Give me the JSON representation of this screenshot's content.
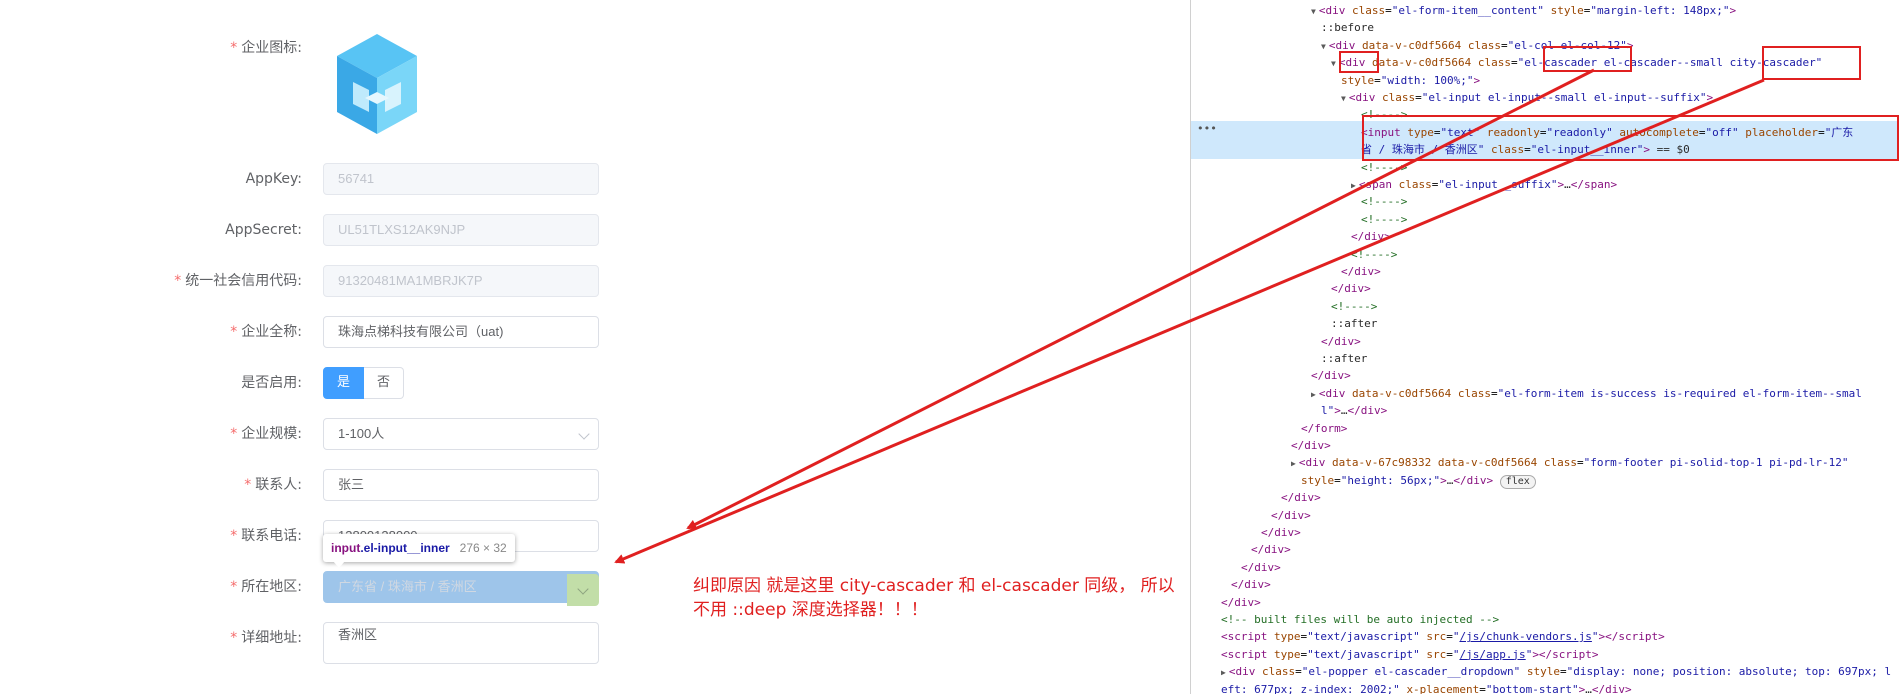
{
  "form": {
    "fields": [
      {
        "label": "企业图标:",
        "required": true
      },
      {
        "label": "AppKey:",
        "required": false,
        "value": "56741"
      },
      {
        "label": "AppSecret:",
        "required": false,
        "value": "UL51TLXS12AK9NJP"
      },
      {
        "label": "统一社会信用代码:",
        "required": true,
        "value": "91320481MA1MBRJK7P"
      },
      {
        "label": "企业全称:",
        "required": true,
        "value": "珠海点梯科技有限公司（uat)"
      },
      {
        "label": "是否启用:",
        "required": false,
        "options": [
          "是",
          "否"
        ],
        "selected": "是"
      },
      {
        "label": "企业规模:",
        "required": true,
        "value": "1-100人"
      },
      {
        "label": "联系人:",
        "required": true,
        "value": "张三"
      },
      {
        "label": "联系电话:",
        "required": true,
        "value": "13800138000"
      },
      {
        "label": "所在地区:",
        "required": true,
        "placeholder": "广东省 / 珠海市 / 香洲区"
      },
      {
        "label": "详细地址:",
        "required": true,
        "value": "香洲区"
      }
    ],
    "required_mark": "*",
    "tooltip": {
      "tag": "input",
      "cls": ".el-input__inner",
      "size": "276 × 32"
    }
  },
  "annotation": {
    "line1": "纠即原因 就是这里 city-cascader 和 el-cascader 同级， 所以",
    "line2": "不用 ::deep 深度选择器！！！"
  },
  "devtools": {
    "lines": [
      {
        "indent": 9,
        "tri": "▼",
        "html": "<span class='t'>&lt;div</span> <span class='a'>class</span>=<span class='v'>\"el-form-item__content\"</span> <span class='a'>style</span>=<span class='v'>\"margin-left: 148px;\"</span><span class='t'>&gt;</span>"
      },
      {
        "indent": 10,
        "html": "<span class='p'>::before</span>"
      },
      {
        "indent": 10,
        "tri": "▼",
        "html": "<span class='t'>&lt;div</span> <span class='a'>data-v-c0df5664</span> <span class='a'>class</span>=<span class='v'>\"el-col el-col-12\"</span><span class='t'>&gt;</span>"
      },
      {
        "indent": 11,
        "tri": "▼",
        "html": "<span class='t'>&lt;div</span> <span class='a'>data-v-c0df5664</span> <span class='a'>class</span>=<span class='v'>\"el-cascader el-cascader--small city-cascader\"</span>"
      },
      {
        "indent": 12,
        "html": "<span class='a'>style</span>=<span class='v'>\"width: 100%;\"</span><span class='t'>&gt;</span>"
      },
      {
        "indent": 12,
        "tri": "▼",
        "html": "<span class='t'>&lt;div</span> <span class='a'>class</span>=<span class='v'>\"el-input el-input--small el-input--suffix\"</span><span class='t'>&gt;</span>"
      },
      {
        "indent": 14,
        "html": "<span class='c'>&lt;!----&gt;</span>"
      },
      {
        "indent": 14,
        "html": "<span class='t'>&lt;input</span> <span class='a'>type</span>=<span class='v'>\"text\"</span> <span class='a'>readonly</span>=<span class='v'>\"readonly\"</span> <span class='a'>autocomplete</span>=<span class='v'>\"off\"</span> <span class='a'>placeholder</span>=<span class='v'>\"广东</span>"
      },
      {
        "indent": 14,
        "html": "<span class='v'>省 / 珠海市 / 香洲区\"</span> <span class='a'>class</span>=<span class='v'>\"el-input__inner\"</span><span class='t'>&gt;</span> <span class='p'>== $0</span>"
      },
      {
        "indent": 14,
        "html": "<span class='c'>&lt;!----&gt;</span>"
      },
      {
        "indent": 13,
        "tri": "▶",
        "html": "<span class='t'>&lt;span</span> <span class='a'>class</span>=<span class='v'>\"el-input__suffix\"</span><span class='t'>&gt;</span><span class='p'>…</span><span class='t'>&lt;/span&gt;</span>"
      },
      {
        "indent": 14,
        "html": "<span class='c'>&lt;!----&gt;</span>"
      },
      {
        "indent": 14,
        "html": "<span class='c'>&lt;!----&gt;</span>"
      },
      {
        "indent": 13,
        "html": "<span class='t'>&lt;/div&gt;</span>"
      },
      {
        "indent": 13,
        "html": "<span class='c'>&lt;!----&gt;</span>"
      },
      {
        "indent": 12,
        "html": "<span class='t'>&lt;/div&gt;</span>"
      },
      {
        "indent": 11,
        "html": "<span class='t'>&lt;/div&gt;</span>"
      },
      {
        "indent": 11,
        "html": "<span class='c'>&lt;!----&gt;</span>"
      },
      {
        "indent": 11,
        "html": "<span class='p'>::after</span>"
      },
      {
        "indent": 10,
        "html": "<span class='t'>&lt;/div&gt;</span>"
      },
      {
        "indent": 10,
        "html": "<span class='p'>::after</span>"
      },
      {
        "indent": 9,
        "html": "<span class='t'>&lt;/div&gt;</span>"
      },
      {
        "indent": 9,
        "tri": "▶",
        "html": "<span class='t'>&lt;div</span> <span class='a'>data-v-c0df5664</span> <span class='a'>class</span>=<span class='v'>\"el-form-item is-success is-required el-form-item--smal</span>"
      },
      {
        "indent": 10,
        "html": "<span class='v'>l\"</span><span class='t'>&gt;</span><span class='p'>…</span><span class='t'>&lt;/div&gt;</span>"
      },
      {
        "indent": 8,
        "html": "<span class='t'>&lt;/form&gt;</span>"
      },
      {
        "indent": 7,
        "html": "<span class='t'>&lt;/div&gt;</span>"
      },
      {
        "indent": 7,
        "tri": "▶",
        "html": "<span class='t'>&lt;div</span> <span class='a'>data-v-67c98332</span> <span class='a'>data-v-c0df5664</span> <span class='a'>class</span>=<span class='v'>\"form-footer pi-solid-top-1 pi-pd-lr-12\"</span>"
      },
      {
        "indent": 8,
        "html": "<span class='a'>style</span>=<span class='v'>\"height: 56px;\"</span><span class='t'>&gt;</span><span class='p'>…</span><span class='t'>&lt;/div&gt;</span> <span class='flexbadge'>flex</span>"
      },
      {
        "indent": 6,
        "html": "<span class='t'>&lt;/div&gt;</span>"
      },
      {
        "indent": 5,
        "html": "<span class='t'>&lt;/div&gt;</span>"
      },
      {
        "indent": 4,
        "html": "<span class='t'>&lt;/div&gt;</span>"
      },
      {
        "indent": 3,
        "html": "<span class='t'>&lt;/div&gt;</span>"
      },
      {
        "indent": 2,
        "html": "<span class='t'>&lt;/div&gt;</span>"
      },
      {
        "indent": 1,
        "html": "<span class='t'>&lt;/div&gt;</span>"
      },
      {
        "indent": 0,
        "html": "<span class='t'>&lt;/div&gt;</span>"
      },
      {
        "indent": 0,
        "html": "<span class='c'>&lt;!-- built files will be auto injected --&gt;</span>"
      },
      {
        "indent": 0,
        "html": "<span class='t'>&lt;script</span> <span class='a'>type</span>=<span class='v'>\"text/javascript\"</span> <span class='a'>src</span>=<span class='v'>\"<span class='lk'>/js/chunk-vendors.js</span>\"</span><span class='t'>&gt;&lt;/script&gt;</span>"
      },
      {
        "indent": 0,
        "html": "<span class='t'>&lt;script</span> <span class='a'>type</span>=<span class='v'>\"text/javascript\"</span> <span class='a'>src</span>=<span class='v'>\"<span class='lk'>/js/app.js</span>\"</span><span class='t'>&gt;&lt;/script&gt;</span>"
      },
      {
        "indent": 0,
        "tri": "▶",
        "html": "<span class='t'>&lt;div</span> <span class='a'>class</span>=<span class='v'>\"el-popper el-cascader__dropdown\"</span> <span class='a'>style</span>=<span class='v'>\"display: none; position: absolute; top: 697px; l</span>"
      },
      {
        "indent": 0,
        "html": "<span class='v'>eft: 677px; z-index: 2002;\"</span> <span class='a'>x-placement</span>=<span class='v'>\"bottom-start\"</span><span class='t'>&gt;</span><span class='p'>…</span><span class='t'>&lt;/div&gt;</span>"
      }
    ],
    "ellipsis_marker": "•••"
  },
  "colors": {
    "accent": "#409eff",
    "required": "#f56c6c",
    "annotation": "#e02020",
    "selected_node": "#cfe8fc"
  }
}
